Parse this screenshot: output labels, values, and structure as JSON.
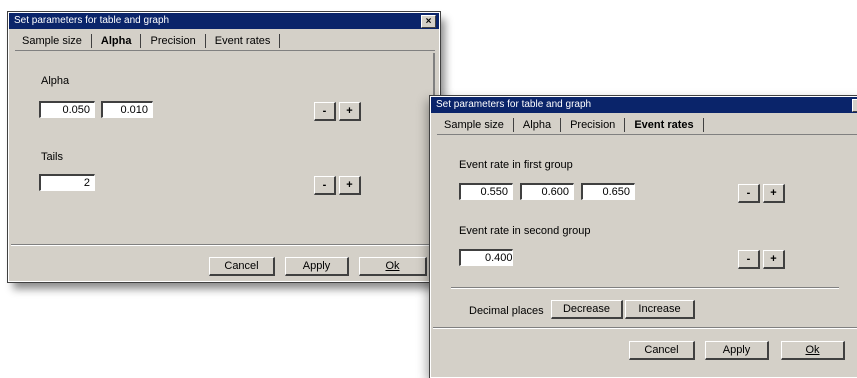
{
  "dialog_alpha": {
    "title": "Set parameters for table and graph",
    "close": "×",
    "tabs": [
      "Sample size",
      "Alpha",
      "Precision",
      "Event rates"
    ],
    "alpha_label": "Alpha",
    "alpha_values": [
      "0.050",
      "0.010"
    ],
    "tails_label": "Tails",
    "tails_value": "2",
    "minus": "-",
    "plus": "+",
    "cancel": "Cancel",
    "apply": "Apply",
    "ok": "Ok"
  },
  "dialog_events": {
    "title": "Set parameters for table and graph",
    "close": "×",
    "tabs": [
      "Sample size",
      "Alpha",
      "Precision",
      "Event rates"
    ],
    "first_label": "Event rate in first group",
    "first_values": [
      "0.550",
      "0.600",
      "0.650"
    ],
    "second_label": "Event rate in second group",
    "second_value": "0.400",
    "minus": "-",
    "plus": "+",
    "decimal_label": "Decimal places",
    "decrease": "Decrease",
    "increase": "Increase",
    "cancel": "Cancel",
    "apply": "Apply",
    "ok": "Ok"
  }
}
